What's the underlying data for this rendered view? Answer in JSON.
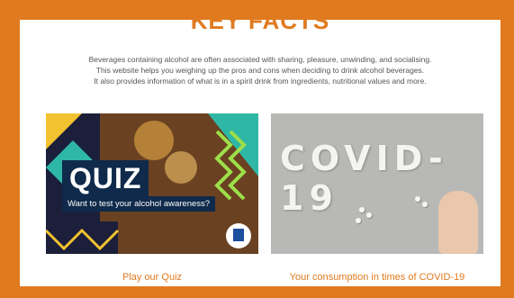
{
  "section": {
    "title": "KEY FACTS",
    "description_lines": [
      "Beverages containing alcohol are often associated with sharing, pleasure, unwinding, and socialising.",
      "This website helps you weighing up the pros and cons when deciding to drink alcohol beverages.",
      "It also provides information of what is in a spirit drink from ingredients, nutritional values and more."
    ]
  },
  "cards": [
    {
      "image_title": "QUIZ",
      "image_subtitle": "Want to test your alcohol awareness?",
      "caption": "Play our Quiz"
    },
    {
      "image_text": "COVID-19",
      "caption": "Your consumption in times of COVID-19"
    }
  ],
  "colors": {
    "accent": "#e07a1f",
    "quiz_panel": "#0f2a4a"
  }
}
